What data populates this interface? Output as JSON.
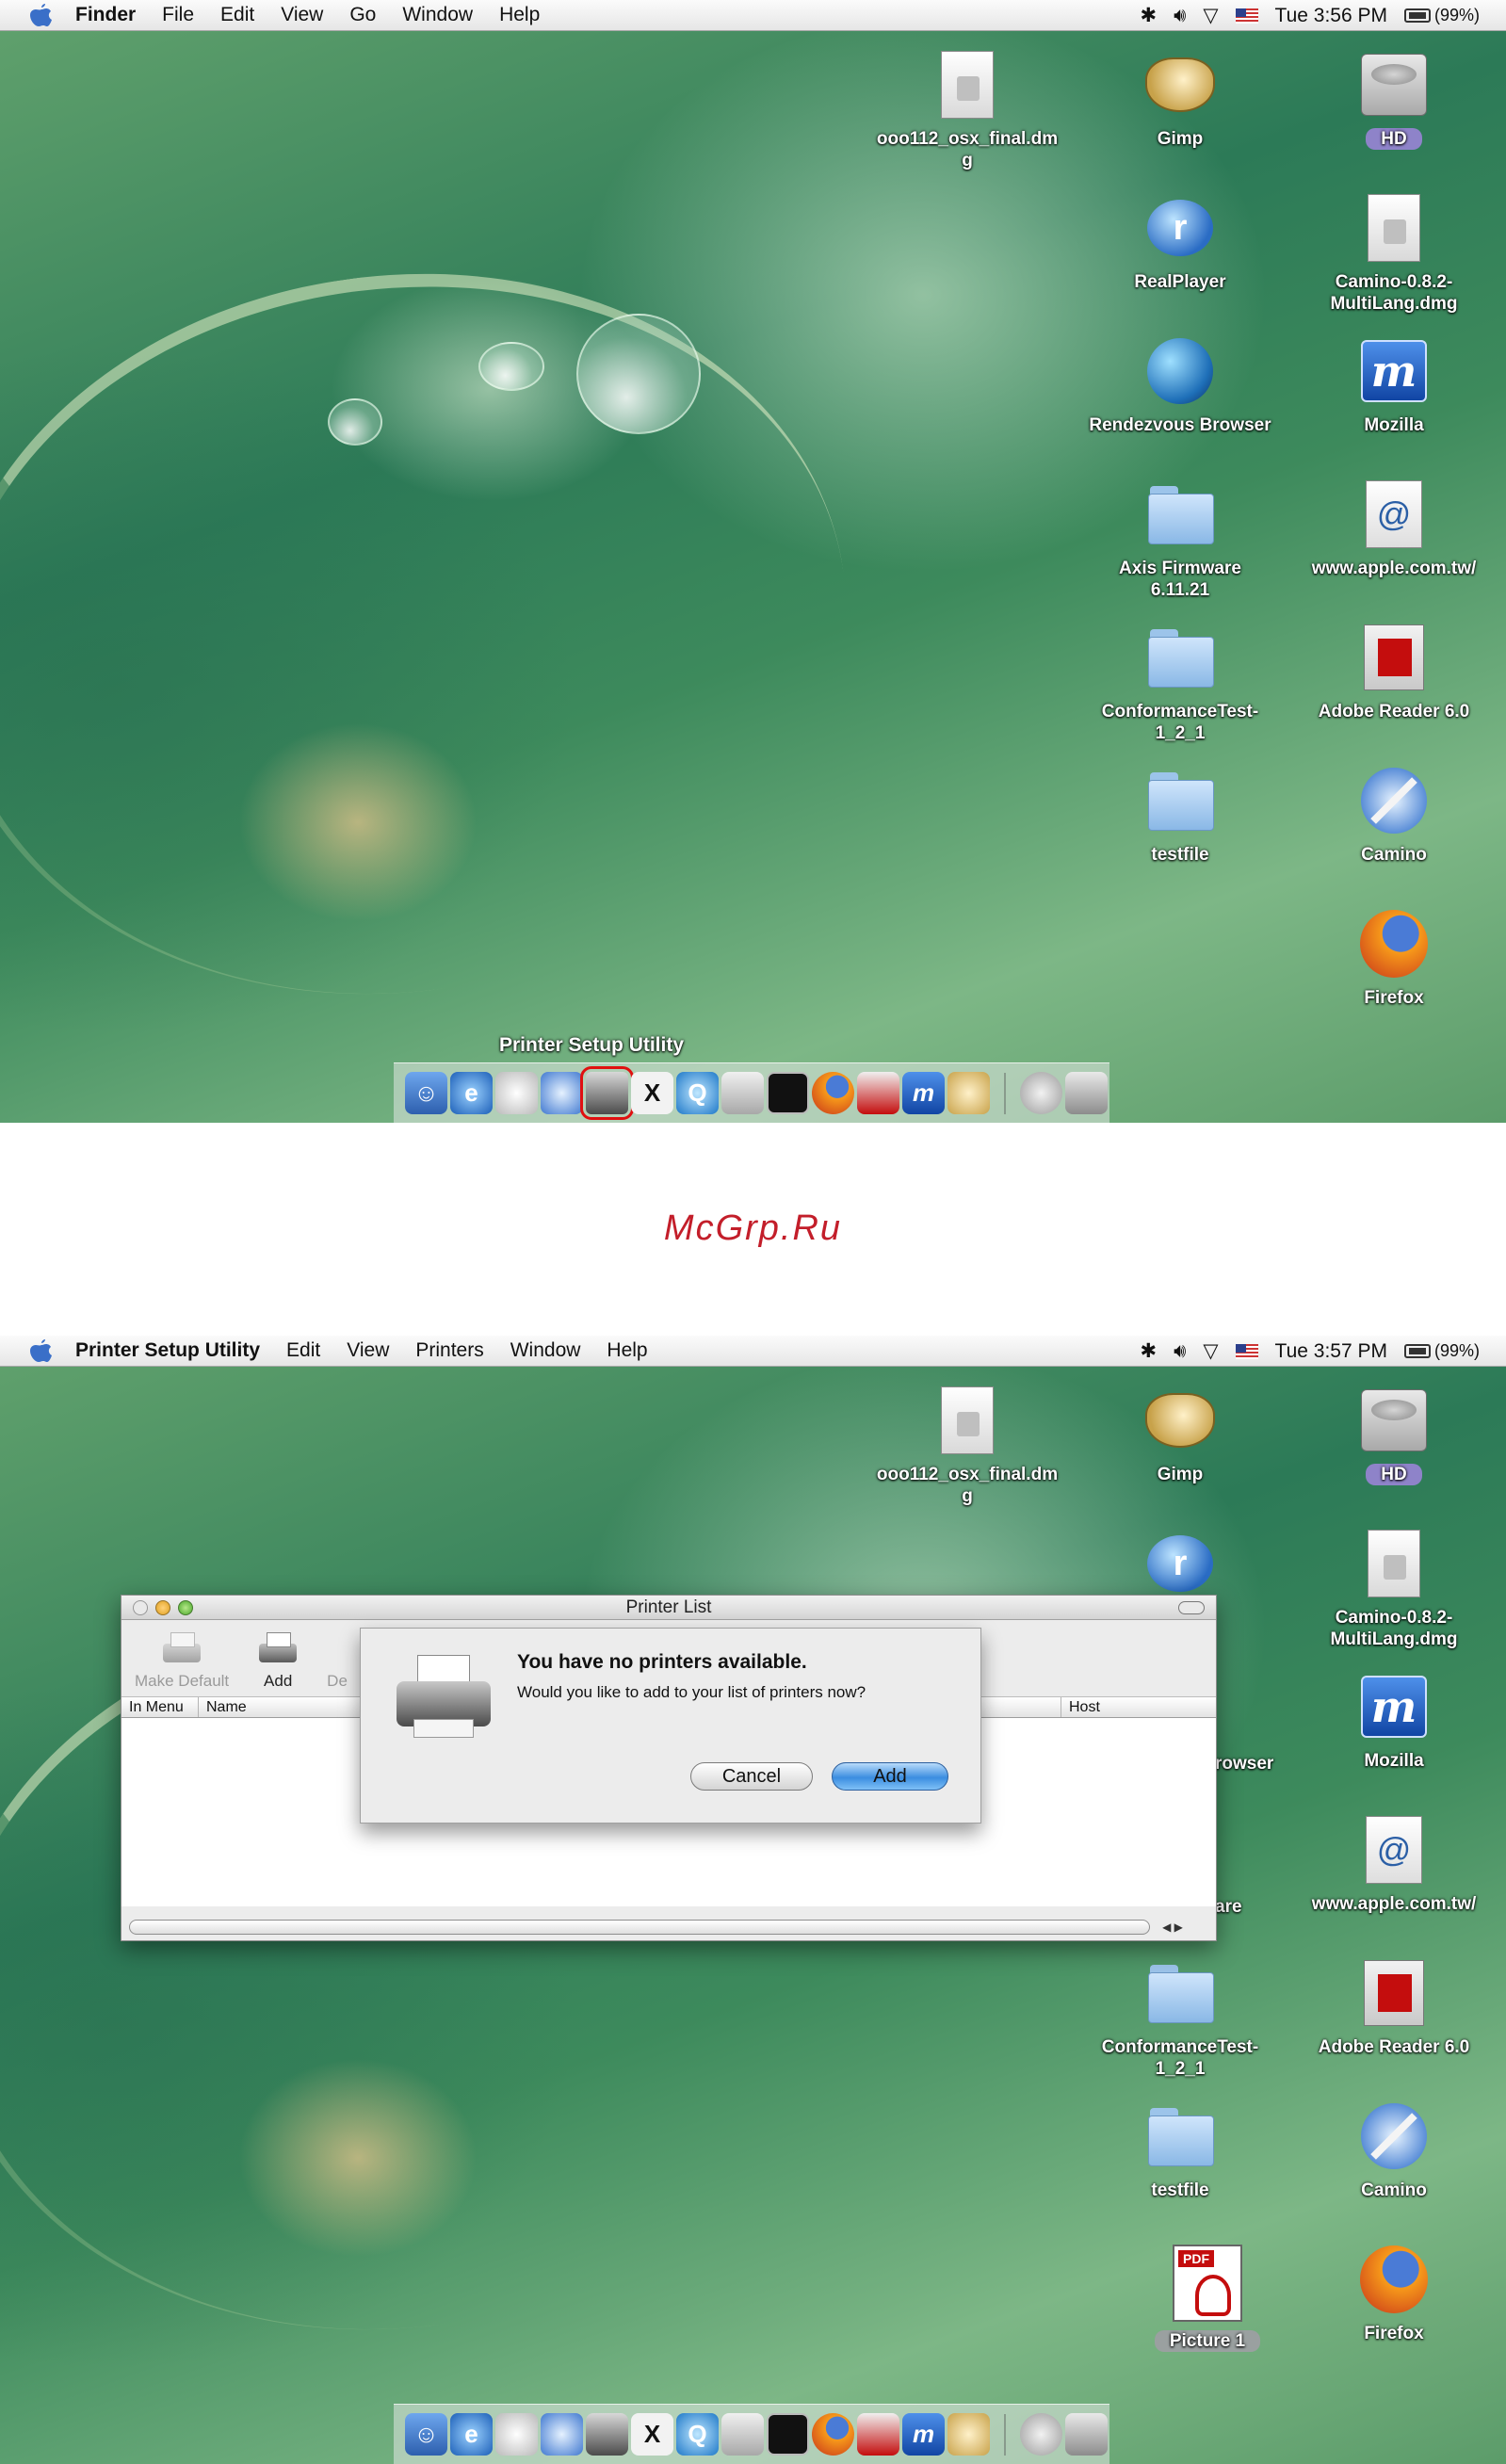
{
  "screen1": {
    "menubar": {
      "app_name": "Finder",
      "menus": [
        "File",
        "Edit",
        "View",
        "Go",
        "Window",
        "Help"
      ],
      "clock": "Tue 3:56 PM",
      "battery": "(99%)"
    },
    "desktop_icons": [
      {
        "label": "ooo112_osx_final.dmg",
        "icon": "disk-image-icon"
      },
      {
        "label": "Gimp",
        "icon": "gimp-icon"
      },
      {
        "label": "HD",
        "icon": "hard-drive-icon"
      },
      {
        "label": "RealPlayer",
        "icon": "realplayer-icon"
      },
      {
        "label": "Camino-0.8.2-MultiLang.dmg",
        "icon": "disk-image-icon"
      },
      {
        "label": "Rendezvous Browser",
        "icon": "globe-icon"
      },
      {
        "label": "Mozilla",
        "icon": "mozilla-icon"
      },
      {
        "label": "Axis Firmware 6.11.21",
        "icon": "folder-icon"
      },
      {
        "label": "www.apple.com.tw/",
        "icon": "web-location-icon"
      },
      {
        "label": "ConformanceTest-1_2_1",
        "icon": "folder-icon"
      },
      {
        "label": "Adobe Reader 6.0",
        "icon": "adobe-reader-icon"
      },
      {
        "label": "testfile",
        "icon": "folder-icon"
      },
      {
        "label": "Camino",
        "icon": "camino-icon"
      },
      {
        "label": "Firefox",
        "icon": "firefox-icon"
      }
    ],
    "dock_tooltip": "Printer Setup Utility",
    "dock_items": [
      "finder",
      "internet-explorer",
      "mail",
      "safari",
      "printer-setup-utility",
      "x11",
      "quicktime",
      "iphoto",
      "terminal",
      "firefox",
      "adobe-reader",
      "mozilla",
      "gimp",
      "cd-drive",
      "trash"
    ]
  },
  "watermark": "McGrp.Ru",
  "screen2": {
    "menubar": {
      "app_name": "Printer Setup Utility",
      "menus": [
        "Edit",
        "View",
        "Printers",
        "Window",
        "Help"
      ],
      "clock": "Tue 3:57 PM",
      "battery": "(99%)"
    },
    "desktop_icons": [
      {
        "label": "ooo112_osx_final.dmg",
        "icon": "disk-image-icon"
      },
      {
        "label": "Gimp",
        "icon": "gimp-icon"
      },
      {
        "label": "HD",
        "icon": "hard-drive-icon"
      },
      {
        "label": "Camino-0.8.2-MultiLang.dmg",
        "icon": "disk-image-icon"
      },
      {
        "label": "Mozilla",
        "icon": "mozilla-icon"
      },
      {
        "label": "www.apple.com.tw/",
        "icon": "web-location-icon"
      },
      {
        "label": "ConformanceTest-1_2_1",
        "icon": "folder-icon"
      },
      {
        "label": "Adobe Reader 6.0",
        "icon": "adobe-reader-icon"
      },
      {
        "label": "testfile",
        "icon": "folder-icon"
      },
      {
        "label": "Camino",
        "icon": "camino-icon"
      },
      {
        "label": "Picture 1",
        "icon": "pdf-icon"
      },
      {
        "label": "Firefox",
        "icon": "firefox-icon"
      }
    ],
    "partially_hidden_labels": [
      "er",
      "rowser",
      "are"
    ],
    "printer_list": {
      "title": "Printer List",
      "toolbar": {
        "make_default": "Make Default",
        "add": "Add",
        "delete_partial": "De"
      },
      "columns": {
        "in_menu": "In Menu",
        "name": "Name",
        "host": "Host"
      }
    },
    "alert": {
      "title": "You have no printers available.",
      "message": "Would you like to add to your list of printers now?",
      "cancel": "Cancel",
      "add": "Add"
    }
  },
  "colors": {
    "dock_highlight": "#e01010",
    "watermark": "#c31e2a",
    "default_button": "#3b8de0",
    "hd_pill": "#8e83c9"
  }
}
